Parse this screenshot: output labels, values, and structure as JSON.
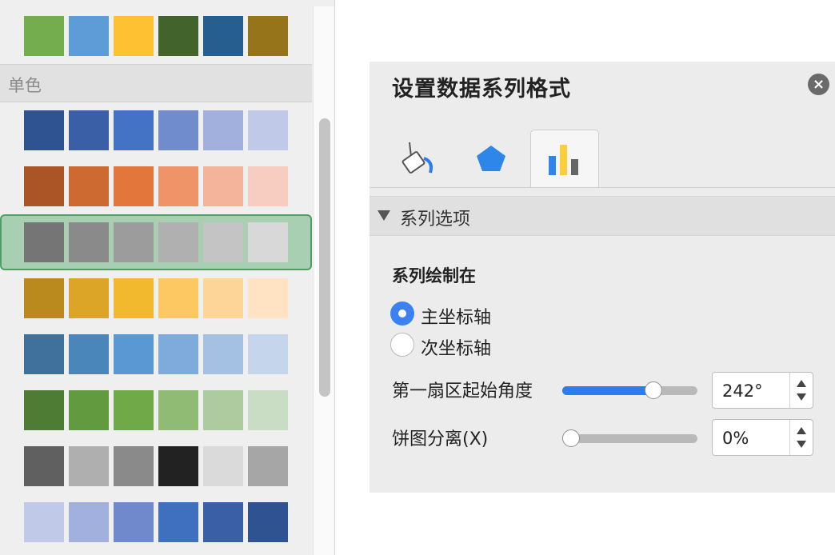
{
  "colors": {
    "selected_row_bg": "#a9cfb3",
    "selected_row_border": "#4e9f66",
    "slider_fill": "#2c7cf0",
    "radio_on": "#3b82f0"
  },
  "picker": {
    "section_label": "单色",
    "top_row": [
      "#74ad4e",
      "#5d9cd6",
      "#fdc132",
      "#42642c",
      "#275e90",
      "#95741a"
    ],
    "rows": [
      [
        "#2f5290",
        "#3a5fa7",
        "#4472c4",
        "#718ccd",
        "#a1b0dc",
        "#c0cae8"
      ],
      [
        "#ab5527",
        "#cc6a32",
        "#e3773b",
        "#ef9469",
        "#f4b49c",
        "#f7ccc1"
      ],
      [
        "#757575",
        "#8a8a8a",
        "#9c9c9c",
        "#b0b0b0",
        "#c4c4c4",
        "#d8d8d8"
      ],
      [
        "#bb8a1f",
        "#dca528",
        "#f2b92e",
        "#fdc862",
        "#fed598",
        "#ffe3c3"
      ],
      [
        "#3f719c",
        "#4a86b9",
        "#5a98d3",
        "#7eaadc",
        "#a4c0e3",
        "#c4d5ec"
      ],
      [
        "#4f7c34",
        "#619a3f",
        "#70a948",
        "#8fbb74",
        "#aecb9f",
        "#c9dcc4"
      ],
      [
        "#606060",
        "#afafaf",
        "#8a8a8a",
        "#222222",
        "#dadada",
        "#a6a6a6"
      ],
      [
        "#c0cae8",
        "#a1b0dc",
        "#6f89cc",
        "#3f6fbf",
        "#3a5fa7",
        "#2f5290"
      ]
    ],
    "selected_row": 2
  },
  "pane": {
    "title": "设置数据系列格式",
    "close_icon": "×",
    "tabs": [
      {
        "name": "fill-line",
        "icon": "paint-bucket-icon"
      },
      {
        "name": "effects",
        "icon": "pentagon-icon"
      },
      {
        "name": "series-options",
        "icon": "bar-chart-icon",
        "active": true
      }
    ],
    "section_title": "系列选项",
    "plot_on_label": "系列绘制在",
    "radio_primary": "主坐标轴",
    "radio_secondary": "次坐标轴",
    "angle_label": "第一扇区起始角度",
    "angle_value": "242°",
    "angle_fraction": 0.672,
    "explosion_label": "饼图分离(X)",
    "explosion_value": "0%",
    "explosion_fraction": 0.0
  }
}
